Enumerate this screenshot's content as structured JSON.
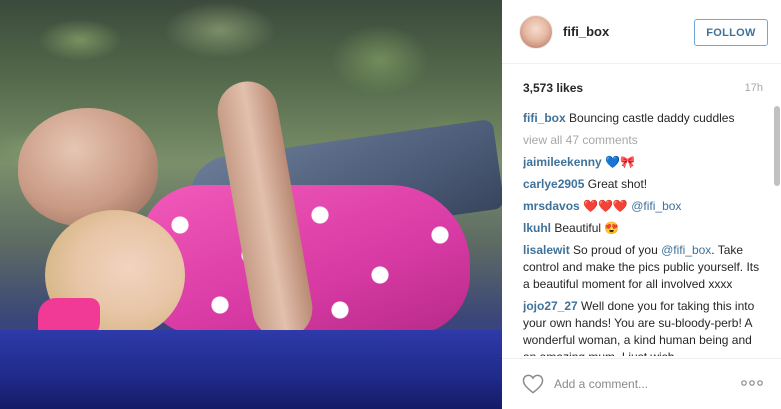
{
  "post": {
    "username": "fifi_box",
    "follow_label": "FOLLOW",
    "likes": "3,573 likes",
    "age": "17h",
    "caption": {
      "user": "fifi_box",
      "text": "Bouncing castle daddy cuddles"
    },
    "view_all": "view all 47 comments",
    "comments": [
      {
        "user": "jaimileekenny",
        "text": "💙🎀"
      },
      {
        "user": "carlye2905",
        "text": "Great shot!"
      },
      {
        "user": "mrsdavos",
        "text": "❤️❤️❤️",
        "mention": "@fifi_box"
      },
      {
        "user": "lkuhl",
        "text": "Beautiful 😍"
      },
      {
        "user": "lisalewit",
        "text_before": "So proud of you ",
        "mention": "@fifi_box",
        "text_after": ". Take control and make the pics public yourself. Its a beautiful moment for all involved xxxx"
      },
      {
        "user": "jojo27_27",
        "text": "Well done you for taking this into your own hands! You are su-bloody-perb! A wonderful woman, a kind human being and an amazing mum. I just wish"
      }
    ],
    "add_comment_placeholder": "Add a comment...",
    "icons": {
      "like": "heart-icon",
      "more": "more-options-icon"
    },
    "colors": {
      "link": "#3f729b",
      "follow_border": "#70a6d9",
      "muted": "#a5a7aa"
    }
  }
}
